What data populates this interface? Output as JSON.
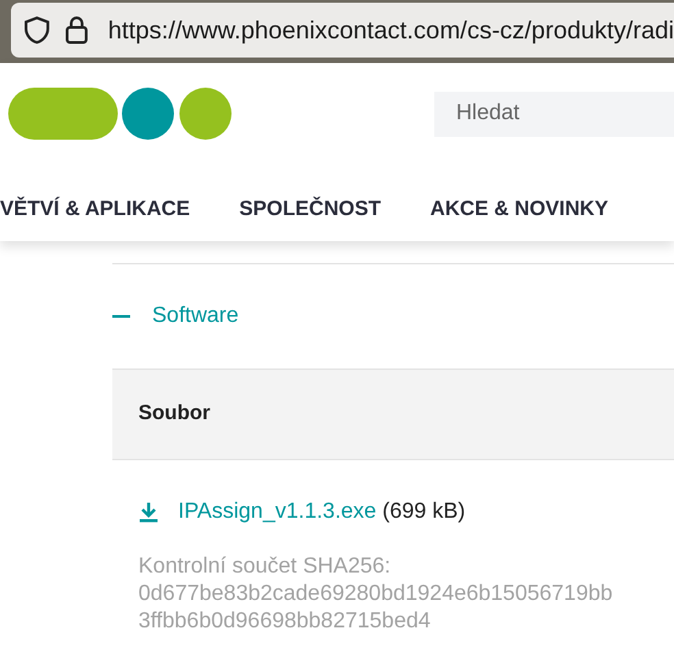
{
  "browser": {
    "url": "https://www.phoenixcontact.com/cs-cz/produkty/radi"
  },
  "header": {
    "search": {
      "placeholder": "Hledat"
    },
    "nav": [
      {
        "label": "VĚTVÍ & APLIKACE"
      },
      {
        "label": "SPOLEČNOST"
      },
      {
        "label": "AKCE & NOVINKY"
      }
    ]
  },
  "section": {
    "title": "Software",
    "expanded": true,
    "table": {
      "columns": [
        "Soubor"
      ],
      "rows": [
        {
          "file": "IPAssign_v1.1.3.exe",
          "size": "(699 kB)",
          "checksum_label": "Kontrolní součet SHA256:",
          "checksum_lines": [
            "0d677be83b2cade69280bd1924e6b15056719bb",
            "3ffbb6b0d96698bb82715bed4"
          ]
        }
      ]
    }
  }
}
